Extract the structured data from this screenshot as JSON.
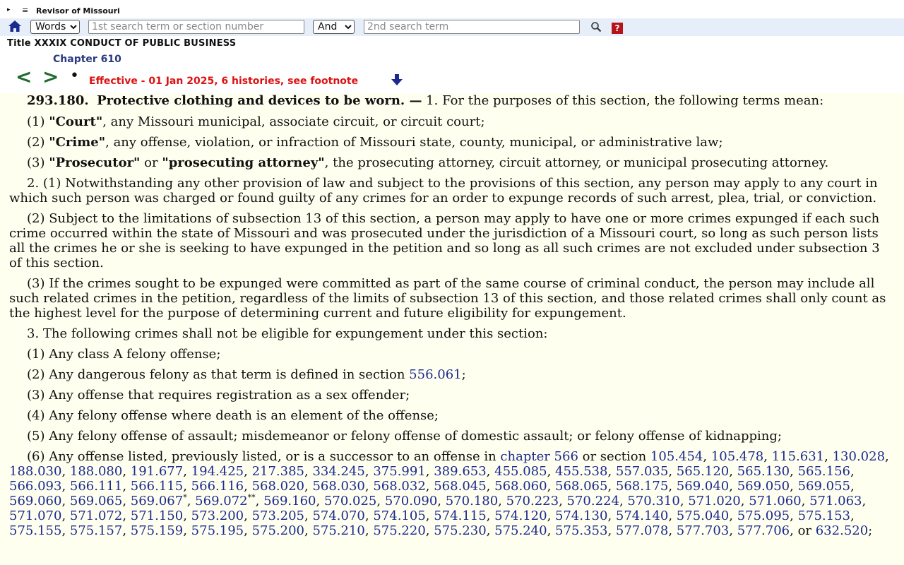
{
  "topbar": {
    "arrow": "▸",
    "menu_icon": "≡",
    "title": "Revisor of Missouri"
  },
  "search": {
    "home_icon": "home-icon",
    "mode_value": "Words",
    "term1_placeholder": "1st search term or section number",
    "op_value": "And",
    "term2_placeholder": "2nd search term",
    "search_icon": "magnifier-icon",
    "help_label": "?"
  },
  "header": {
    "title_line": "Title XXXIX CONDUCT OF PUBLIC BUSINESS",
    "chapter": "Chapter 610",
    "prev": "<",
    "next": ">",
    "dot": "•",
    "effective": "Effective - 01 Jan 2025, 6 histories, see footnote"
  },
  "colors": {
    "link": "#1b2a8e",
    "effective": "#dd1111",
    "nav": "#1f6c2c",
    "band": "#e6eefa",
    "page": "#fffff0"
  },
  "content": {
    "section_number": "293.180.",
    "section_title": "Protective clothing and devices to be worn. —",
    "intro": " 1.  For the purposes of this section, the following terms mean:",
    "def1_num": "(1) ",
    "def1_term": "\"Court\"",
    "def1_text": ", any Missouri municipal, associate circuit, or circuit court;",
    "def2_num": "(2) ",
    "def2_term": "\"Crime\"",
    "def2_text": ", any offense, violation, or infraction of Missouri state, county, municipal, or administrative law;",
    "def3_num": "(3) ",
    "def3_term_a": "\"Prosecutor\"",
    "def3_or": " or ",
    "def3_term_b": "\"prosecuting attorney\"",
    "def3_text": ", the prosecuting attorney, circuit attorney, or municipal prosecuting attorney.",
    "para2_1": "2.  (1)  Notwithstanding any other provision of law and subject to the provisions of this section, any person may apply to any court in which such person was charged or found guilty of any crimes for an order to expunge records of such arrest, plea, trial, or conviction.",
    "para2_2": "(2)  Subject to the limitations of subsection 13 of this section, a person may apply to have one or more crimes expunged if each such crime occurred within the state of Missouri and was prosecuted under the jurisdiction of a Missouri court, so long as such person lists all the crimes he or she is seeking to have expunged in the petition and so long as all such crimes are not excluded under subsection 3 of this section.",
    "para2_3": "(3)  If the crimes sought to be expunged were committed as part of the same course of criminal conduct, the person may include all such related crimes in the petition, regardless of the limits of subsection 13 of this section, and those related crimes shall only count as the highest level for the purpose of determining current and future eligibility for expungement.",
    "para3_intro": "3.  The following crimes shall not be eligible for expungement under this section:",
    "item1": "(1)  Any class A felony offense;",
    "item2_pre": "(2)  Any dangerous felony as that term is defined in section ",
    "item2_link": "556.061",
    "item2_post": ";",
    "item3": "(3)  Any offense that requires registration as a sex offender;",
    "item4": "(4)  Any felony offense where death is an element of the offense;",
    "item5": "(5)  Any felony offense of assault; misdemeanor or felony offense of domestic assault; or felony offense of kidnapping;",
    "item6_pre": "(6)  Any offense listed, previously listed, or is a successor to an offense in ",
    "item6_chapter": "chapter 566",
    "item6_mid": " or section ",
    "item6_links": [
      "105.454",
      "105.478",
      "115.631",
      "130.028",
      "188.030",
      "188.080",
      "191.677",
      "194.425",
      "217.385",
      "334.245",
      "375.991",
      "389.653",
      "455.085",
      "455.538",
      "557.035",
      "565.120",
      "565.130",
      "565.156",
      "566.093",
      "566.111",
      "566.115",
      "566.116",
      "568.020",
      "568.030",
      "568.032",
      "568.045",
      "568.060",
      "568.065",
      "568.175",
      "569.040",
      "569.050",
      "569.055",
      "569.060",
      "569.065",
      "569.067",
      "569.072",
      "569.160",
      "570.025",
      "570.090",
      "570.180",
      "570.223",
      "570.224",
      "570.310",
      "571.020",
      "571.060",
      "571.063",
      "571.070",
      "571.072",
      "571.150",
      "573.200",
      "573.205",
      "574.070",
      "574.105",
      "574.115",
      "574.120",
      "574.130",
      "574.140",
      "575.040",
      "575.095",
      "575.153",
      "575.155",
      "575.157",
      "575.159",
      "575.195",
      "575.200",
      "575.210",
      "575.220",
      "575.230",
      "575.240",
      "575.353",
      "577.078",
      "577.703",
      "577.706"
    ],
    "item6_sup": {
      "569.067": "*",
      "569.072": "**"
    },
    "item6_or": ", or ",
    "item6_last": "632.520",
    "item6_end": ";"
  }
}
